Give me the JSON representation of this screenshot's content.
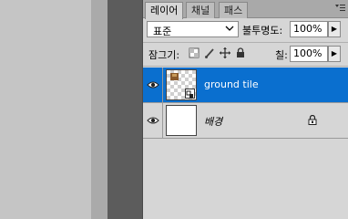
{
  "tabs": [
    {
      "label": "레이어",
      "active": true
    },
    {
      "label": "채널",
      "active": false
    },
    {
      "label": "패스",
      "active": false
    }
  ],
  "panel_menu_icon": "panel-menu-icon",
  "blend_mode": {
    "value": "표준"
  },
  "opacity": {
    "label": "불투명도:",
    "value": "100%"
  },
  "lock": {
    "label": "잠그기:",
    "icons": [
      "lock-transparent-icon",
      "lock-brush-icon",
      "lock-move-icon",
      "lock-all-icon"
    ]
  },
  "fill": {
    "label": "칠:",
    "value": "100%"
  },
  "layers": [
    {
      "name": "ground tile",
      "selected": true,
      "visible": true,
      "smart_object": true,
      "locked": false
    },
    {
      "name": "배경",
      "selected": false,
      "visible": true,
      "smart_object": false,
      "locked": true
    }
  ],
  "colors": {
    "selection": "#0a6fcf",
    "panel": "#d6d6d6",
    "tab_bar": "#a9a9a9"
  }
}
